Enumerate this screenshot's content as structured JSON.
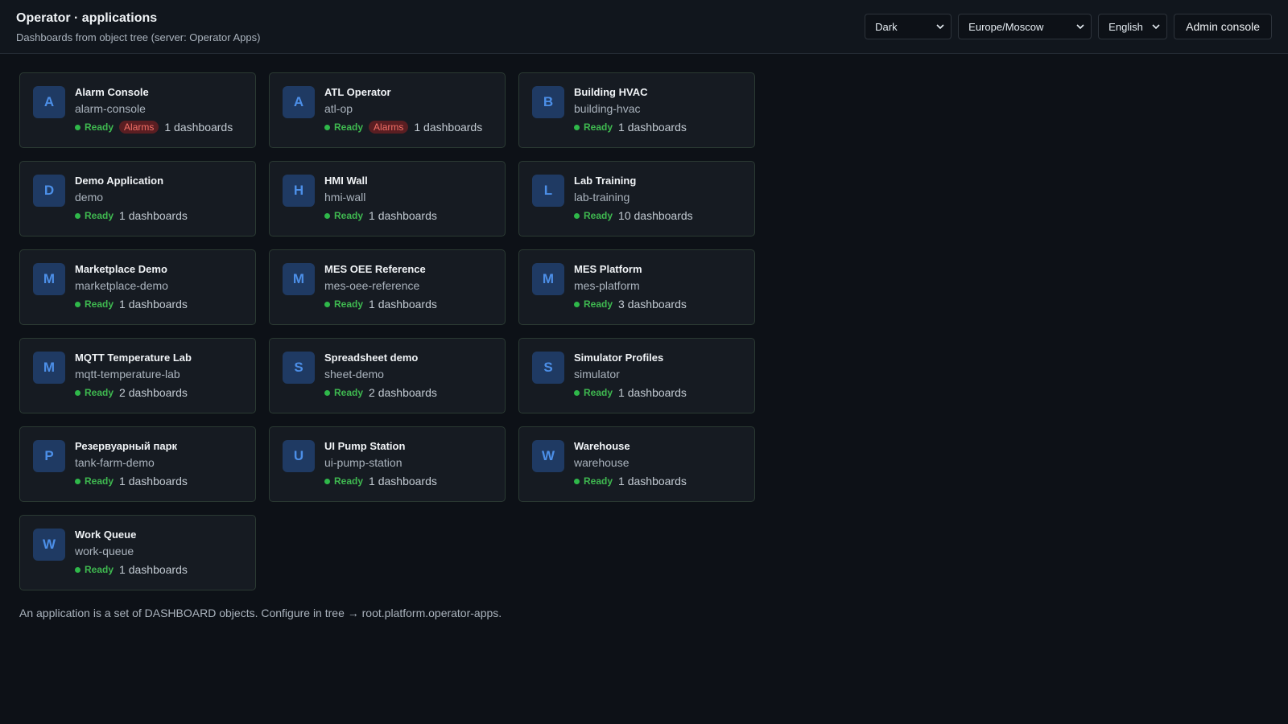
{
  "header": {
    "title": "Operator · applications",
    "subtitle": "Dashboards from object tree (server: Operator Apps)"
  },
  "controls": {
    "theme": "Dark",
    "timezone": "Europe/Moscow",
    "language": "English",
    "admin_label": "Admin console",
    "chevron_icon": "chevron-down-icon"
  },
  "status": {
    "ready_label": "Ready",
    "alarm_label": "Alarms"
  },
  "colors": {
    "accent": "#4c8fe8",
    "ready": "#3fb950",
    "alarm": "#f47067"
  },
  "apps": [
    {
      "letter": "A",
      "name": "Alarm Console",
      "slug": "alarm-console",
      "alarm": true,
      "dashboards": "1 dashboards"
    },
    {
      "letter": "A",
      "name": "ATL Operator",
      "slug": "atl-op",
      "alarm": true,
      "dashboards": "1 dashboards"
    },
    {
      "letter": "B",
      "name": "Building HVAC",
      "slug": "building-hvac",
      "alarm": false,
      "dashboards": "1 dashboards"
    },
    {
      "letter": "D",
      "name": "Demo Application",
      "slug": "demo",
      "alarm": false,
      "dashboards": "1 dashboards"
    },
    {
      "letter": "H",
      "name": "HMI Wall",
      "slug": "hmi-wall",
      "alarm": false,
      "dashboards": "1 dashboards"
    },
    {
      "letter": "L",
      "name": "Lab Training",
      "slug": "lab-training",
      "alarm": false,
      "dashboards": "10 dashboards"
    },
    {
      "letter": "M",
      "name": "Marketplace Demo",
      "slug": "marketplace-demo",
      "alarm": false,
      "dashboards": "1 dashboards"
    },
    {
      "letter": "M",
      "name": "MES OEE Reference",
      "slug": "mes-oee-reference",
      "alarm": false,
      "dashboards": "1 dashboards"
    },
    {
      "letter": "M",
      "name": "MES Platform",
      "slug": "mes-platform",
      "alarm": false,
      "dashboards": "3 dashboards"
    },
    {
      "letter": "M",
      "name": "MQTT Temperature Lab",
      "slug": "mqtt-temperature-lab",
      "alarm": false,
      "dashboards": "2 dashboards"
    },
    {
      "letter": "S",
      "name": "Spreadsheet demo",
      "slug": "sheet-demo",
      "alarm": false,
      "dashboards": "2 dashboards"
    },
    {
      "letter": "S",
      "name": "Simulator Profiles",
      "slug": "simulator",
      "alarm": false,
      "dashboards": "1 dashboards"
    },
    {
      "letter": "P",
      "name": "Резервуарный парк",
      "slug": "tank-farm-demo",
      "alarm": false,
      "dashboards": "1 dashboards"
    },
    {
      "letter": "U",
      "name": "UI Pump Station",
      "slug": "ui-pump-station",
      "alarm": false,
      "dashboards": "1 dashboards"
    },
    {
      "letter": "W",
      "name": "Warehouse",
      "slug": "warehouse",
      "alarm": false,
      "dashboards": "1 dashboards"
    },
    {
      "letter": "W",
      "name": "Work Queue",
      "slug": "work-queue",
      "alarm": false,
      "dashboards": "1 dashboards"
    }
  ],
  "footer": {
    "note": "An application is a set of DASHBOARD objects. Configure in tree → root.platform.operator-apps."
  }
}
